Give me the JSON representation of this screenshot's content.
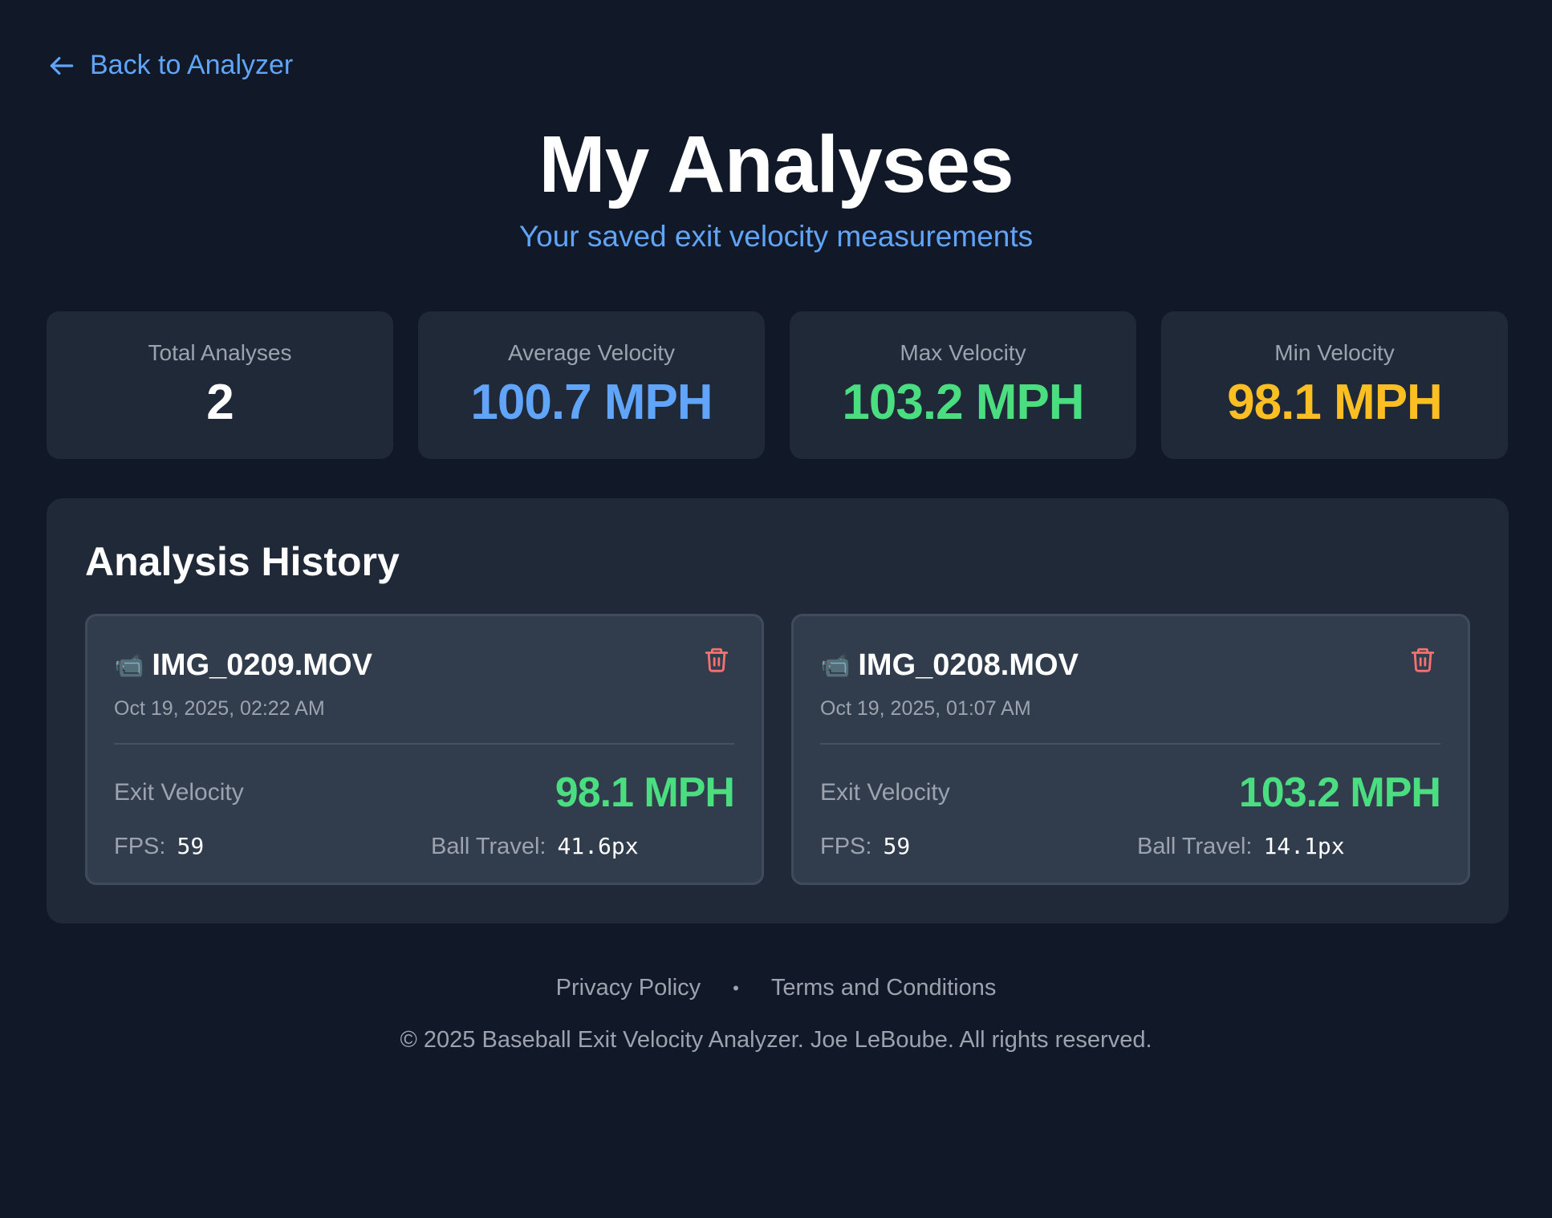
{
  "nav": {
    "back_label": "Back to Analyzer"
  },
  "header": {
    "title": "My Analyses",
    "subtitle": "Your saved exit velocity measurements"
  },
  "stats": [
    {
      "label": "Total Analyses",
      "value": "2",
      "color": "#ffffff"
    },
    {
      "label": "Average Velocity",
      "value": "100.7 MPH",
      "color": "#60a5fa"
    },
    {
      "label": "Max Velocity",
      "value": "103.2 MPH",
      "color": "#4ade80"
    },
    {
      "label": "Min Velocity",
      "value": "98.1 MPH",
      "color": "#fbbf24"
    }
  ],
  "history": {
    "title": "Analysis History",
    "items": [
      {
        "icon": "📹",
        "filename": "IMG_0209.MOV",
        "date": "Oct 19, 2025, 02:22 AM",
        "velocity_label": "Exit Velocity",
        "velocity": "98.1 MPH",
        "fps_label": "FPS:",
        "fps": "59",
        "travel_label": "Ball Travel:",
        "travel": "41.6px"
      },
      {
        "icon": "📹",
        "filename": "IMG_0208.MOV",
        "date": "Oct 19, 2025, 01:07 AM",
        "velocity_label": "Exit Velocity",
        "velocity": "103.2 MPH",
        "fps_label": "FPS:",
        "fps": "59",
        "travel_label": "Ball Travel:",
        "travel": "14.1px"
      }
    ]
  },
  "footer": {
    "privacy": "Privacy Policy",
    "separator": "•",
    "terms": "Terms and Conditions",
    "copyright": "© 2025 Baseball Exit Velocity Analyzer. Joe LeBoube. All rights reserved."
  },
  "colors": {
    "background": "#111827",
    "card": "#1f2937",
    "accent_blue": "#60a5fa",
    "accent_green": "#4ade80",
    "accent_yellow": "#fbbf24",
    "delete_red": "#f87171"
  }
}
